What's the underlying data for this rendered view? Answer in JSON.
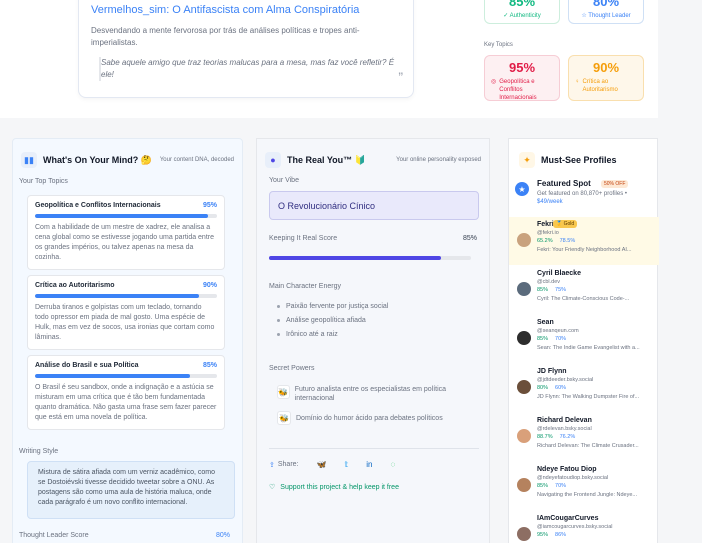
{
  "top": {
    "profile_title": "Vermelhos_sim: O Antifascista com Alma Conspiratória",
    "profile_desc": "Desvendando a mente fervorosa por trás de análises políticas e tropes anti-imperialistas.",
    "profile_quote": "Sabe aquele amigo que traz teorias malucas para a mesa, mas faz você refletir? É ele!",
    "stats": [
      {
        "value": "85%",
        "label": "Authenticity",
        "color": "#10b981"
      },
      {
        "value": "80%",
        "label": "Thought Leader",
        "color": "#3b82f6"
      }
    ],
    "key_topics_label": "Key Topics",
    "topics": [
      {
        "value": "95%",
        "label": "Geopolítica e Conflitos Internacionais",
        "color": "#e11d48"
      },
      {
        "value": "90%",
        "label": "Crítica ao Autoritarismo",
        "color": "#f59e0b"
      }
    ]
  },
  "col1": {
    "title": "What's On Your Mind? 🤔",
    "subtitle": "Your content DNA, decoded",
    "section": "Your Top Topics",
    "topics": [
      {
        "name": "Geopolítica e Conflitos Internacionais",
        "pct": "95%",
        "level": 95,
        "desc": "Com a habilidade de um mestre de xadrez, ele analisa a cena global como se estivesse jogando uma partida entre os grandes impérios, ou talvez apenas na mesa da cozinha."
      },
      {
        "name": "Crítica ao Autoritarismo",
        "pct": "90%",
        "level": 90,
        "desc": "Derruba tiranos e golpistas com um teclado, tornando todo opressor em piada de mal gosto. Uma espécie de Hulk, mas em vez de socos, usa ironias que cortam como lâminas."
      },
      {
        "name": "Análise do Brasil e sua Política",
        "pct": "85%",
        "level": 85,
        "desc": "O Brasil é seu sandbox, onde a indignação e a astúcia se misturam em uma crítica que é tão bem fundamentada quanto dramática. Não gasta uma frase sem fazer parecer que está em uma novela de política."
      }
    ],
    "writing_label": "Writing Style",
    "writing_text": "Mistura de sátira afiada com um verniz acadêmico, como se Dostoiévski tivesse decidido tweetar sobre a ONU. As postagens são como uma aula de história maluca, onde cada parágrafo é um novo conflito internacional.",
    "thought_label": "Thought Leader Score",
    "thought_value": "80%"
  },
  "col2": {
    "title": "The Real You™ 🔰",
    "subtitle": "Your online personality exposed",
    "vibe_label": "Your Vibe",
    "vibe": "O Revolucionário Cínico",
    "keeping_label": "Keeping It Real Score",
    "keeping_value": "85%",
    "keeping_level": 85,
    "energy_label": "Main Character Energy",
    "energy": [
      "Paixão fervente por justiça social",
      "Análise geopolítica afiada",
      "Irônico até a raiz"
    ],
    "powers_label": "Secret Powers",
    "powers": [
      "Futuro analista entre os especialistas em política internacional",
      "Domínio do humor ácido para debates políticos"
    ],
    "share_label": "Share:",
    "support": "Support this project & help keep it free"
  },
  "col3": {
    "title": "Must-See Profiles",
    "featured_title": "Featured Spot",
    "featured_badge": "50% OFF",
    "featured_text": "Get featured on 80,870+ profiles •",
    "featured_price": "$49/week",
    "profiles": [
      {
        "name": "Fekri",
        "badge": "🥇 Gold",
        "handle": "@fekri.io",
        "s1": "65.2%",
        "s2": "78.5%",
        "bio": "Fekri: Your Friendly Neighborhood AI...",
        "color": "#c9a27e"
      },
      {
        "name": "Cyril Blaecke",
        "handle": "@cbl.dev",
        "s1": "85%",
        "s2": "75%",
        "bio": "Cyril: The Climate-Conscious Code-...",
        "color": "#5b6b7c"
      },
      {
        "name": "Sean",
        "handle": "@seanqeun.com",
        "s1": "85%",
        "s2": "70%",
        "bio": "Sean: The Indie Game Evangelist with a...",
        "color": "#2d2d2d"
      },
      {
        "name": "JD Flynn",
        "handle": "@jdtdeeder.bsky.social",
        "s1": "80%",
        "s2": "60%",
        "bio": "JD Flynn: The Walking Dumpster Fire of...",
        "color": "#6b4f3a"
      },
      {
        "name": "Richard Delevan",
        "handle": "@rdelevan.bsky.social",
        "s1": "88.7%",
        "s2": "76.2%",
        "bio": "Richard Delevan: The Climate Crusader...",
        "color": "#d9a07a"
      },
      {
        "name": "Ndeye Fatou Diop",
        "handle": "@ndeyefatoudiop.bsky.social",
        "s1": "85%",
        "s2": "70%",
        "bio": "Navigating the Frontend Jungle: Ndeye...",
        "color": "#b5825e"
      },
      {
        "name": "IAmCougarCurves",
        "handle": "@iamcougarcurves.bsky.social",
        "s1": "95%",
        "s2": "86%",
        "bio": "",
        "color": "#8d6e63"
      }
    ]
  }
}
